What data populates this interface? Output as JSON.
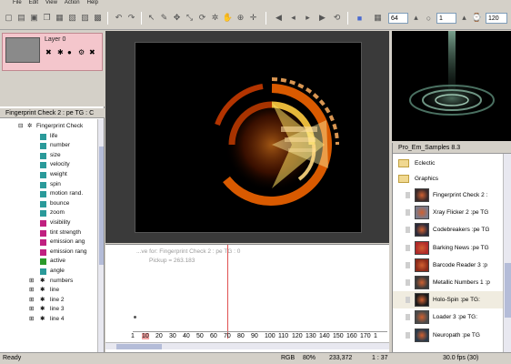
{
  "menu": [
    "File",
    "Edit",
    "View",
    "Action",
    "Help"
  ],
  "toolbar": {
    "width_value": "64",
    "scale_value": "1",
    "frames_value": "120"
  },
  "layer": {
    "name": "Layer 0"
  },
  "tree": {
    "title": "Fingerprint Check 2 : pe TG : C",
    "root": "Fingerprint Check",
    "items": [
      {
        "label": "life",
        "color": "#2a9a9a"
      },
      {
        "label": "number",
        "color": "#2a9a9a"
      },
      {
        "label": "size",
        "color": "#2a9a9a"
      },
      {
        "label": "velocity",
        "color": "#2a9a9a"
      },
      {
        "label": "weight",
        "color": "#2a9a9a"
      },
      {
        "label": "spin",
        "color": "#2a9a9a"
      },
      {
        "label": "motion rand.",
        "color": "#2a9a9a"
      },
      {
        "label": "bounce",
        "color": "#2a9a9a"
      },
      {
        "label": "zoom",
        "color": "#2a9a9a"
      },
      {
        "label": "visibility",
        "color": "#c02080"
      },
      {
        "label": "tint strength",
        "color": "#c02080"
      },
      {
        "label": "emission ang",
        "color": "#c02080"
      },
      {
        "label": "emission rang",
        "color": "#c02080"
      },
      {
        "label": "active",
        "color": "#2a9a2a"
      },
      {
        "label": "angle",
        "color": "#2a9a9a"
      }
    ],
    "groups": [
      "numbers",
      "line",
      "line 2",
      "line 3",
      "line 4"
    ]
  },
  "timeline": {
    "info_line1": "...ve for: Fingerprint Check 2 : pe TG : 0",
    "info_line2": "Pickup = 263.183",
    "ticks": [
      "1",
      "10",
      "20",
      "30",
      "40",
      "50",
      "60",
      "70",
      "80",
      "90",
      "100",
      "110",
      "120",
      "130",
      "140",
      "150",
      "160",
      "170",
      "1"
    ]
  },
  "browser": {
    "title": "Pro_Em_Samples 8.3",
    "folders": [
      "Eclectic",
      "Graphics"
    ],
    "items": [
      {
        "label": "Fingerprint Check 2 :",
        "thumb": "#3a2a2a"
      },
      {
        "label": "Xray Flicker 2 :pe TG",
        "thumb": "#7a7a8a"
      },
      {
        "label": "Codebreakers :pe TG",
        "thumb": "#2a2a3a"
      },
      {
        "label": "Barking News :pe TG",
        "thumb": "#b02a2a"
      },
      {
        "label": "Barcode Reader 3 :p",
        "thumb": "#8a2a1a"
      },
      {
        "label": "Metallic Numbers 1 :p",
        "thumb": "#3a3a3a"
      },
      {
        "label": "Holo-Spin :pe TG:",
        "thumb": "#1a1a1a",
        "selected": true
      },
      {
        "label": "Loader 3 :pe TG:",
        "thumb": "#4a4a4a"
      },
      {
        "label": "Neuropath :pe TG",
        "thumb": "#2a3a4a"
      }
    ]
  },
  "status": {
    "ready": "Ready",
    "mode": "RGB",
    "zoom": "80%",
    "coords": "233,372",
    "frame": "1 : 37",
    "fps": "30.0 fps (30)"
  }
}
